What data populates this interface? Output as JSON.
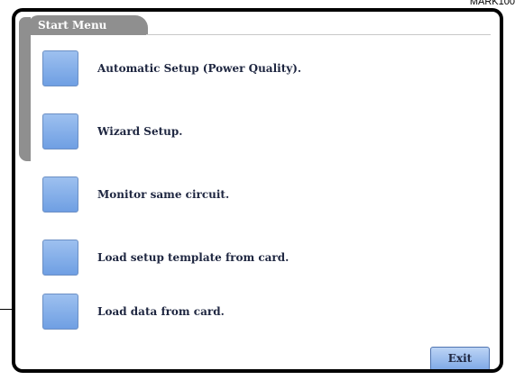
{
  "corner_label": "MARK100",
  "start_menu": {
    "title": "Start Menu",
    "items": [
      {
        "label": "Automatic Setup (Power Quality)."
      },
      {
        "label": "Wizard Setup."
      },
      {
        "label": "Monitor same circuit."
      },
      {
        "label": "Load setup template from card."
      },
      {
        "label": "Load data from card."
      }
    ],
    "exit_label": "Exit"
  },
  "colors": {
    "tab_gray": "#8f8f8f",
    "button_blue": "#7aa6e6",
    "text_dark": "#1e2640"
  }
}
